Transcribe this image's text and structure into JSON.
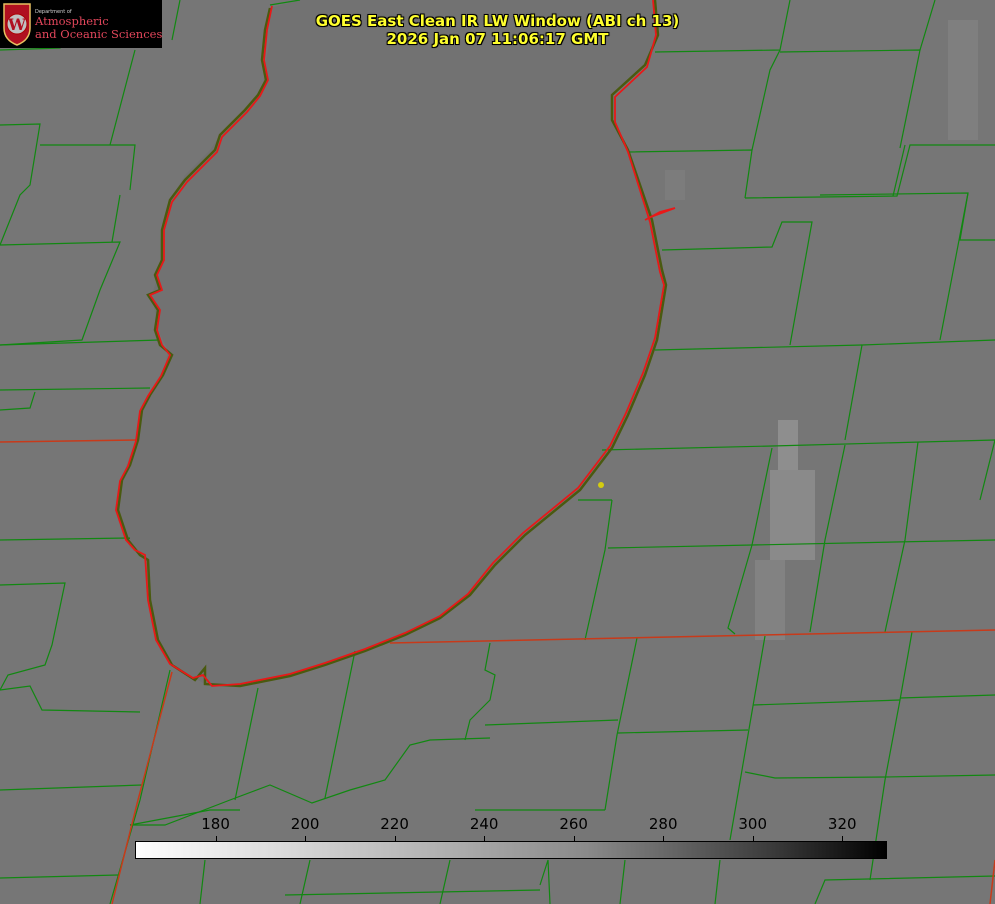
{
  "title": {
    "line1": "GOES East Clean IR LW Window (ABI ch 13)",
    "line2": "2026 Jan 07 11:06:17 GMT"
  },
  "logo": {
    "dept": "Department of",
    "line1": "Atmospheric",
    "line2": "and Oceanic Sciences",
    "seal_letter": "W"
  },
  "colors": {
    "background_gray": "#747474",
    "lake_gray": "#727272",
    "county_lines": "#118811",
    "state_lines": "#c83a1a",
    "coastline": "#e81818",
    "title_text": "#ffff2e",
    "station_dot": "#d4cc10"
  },
  "colorbar": {
    "ticks": [
      "180",
      "200",
      "220",
      "240",
      "260",
      "280",
      "300",
      "320"
    ],
    "range": [
      162,
      330
    ]
  }
}
